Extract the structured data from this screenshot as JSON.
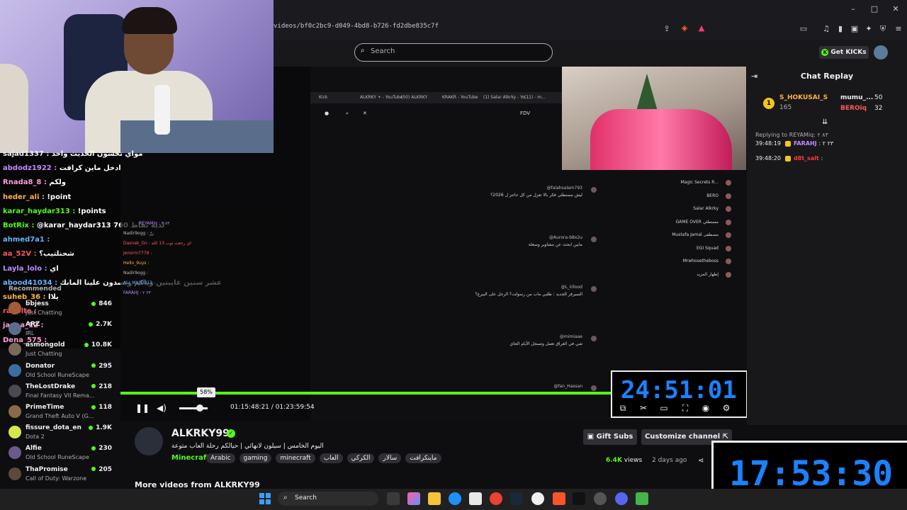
{
  "browser": {
    "url": "videos/bf0c2bc9-d049-4bd8-b726-fd2dbe835c7f"
  },
  "header": {
    "search_placeholder": "Search",
    "get_kicks": "Get KICKs"
  },
  "stream_chat_overlay": [
    {
      "user": "sajad1337 :",
      "msg": "مواي تحسون الحديث واحد",
      "color": "#efeff1"
    },
    {
      "user": "abdodz1922 :",
      "msg": "ادخل ماين كرافت",
      "color": "#c08cff"
    },
    {
      "user": "Rnada8_8 :",
      "msg": "ولكم",
      "color": "#ff9dd6"
    },
    {
      "user": "heder_ali :",
      "msg": "!point",
      "color": "#ffb347"
    },
    {
      "user": "karar_haydar313 :",
      "msg": "!points",
      "color": "#53fc18"
    },
    {
      "user": "BotRix :",
      "msg": "@karar_haydar313 لديه نقاط 760",
      "color": "#53fc18"
    },
    {
      "user": "ahmed7a1 :",
      "msg": "",
      "color": "#66b3ff"
    },
    {
      "user": "aa_52V :",
      "msg": "شحنلتيب؟",
      "color": "#ff5a5a"
    },
    {
      "user": "Layla_lolo :",
      "msg": "اي",
      "color": "#c08cff"
    },
    {
      "user": "abood41034 :",
      "msg": "عشر سنين غايبتين وياكم وتسدون علينا المابك",
      "color": "#66b3ff"
    },
    {
      "user": "suheb_36 :",
      "msg": "يلاا",
      "color": "#ffb347"
    },
    {
      "user": "rabolte :",
      "msg": "",
      "color": "#ff5a5a"
    },
    {
      "user": "janna_12 :",
      "msg": "",
      "color": "#ff9dd6"
    },
    {
      "user": "Dena_575 :",
      "msg": "",
      "color": "#ff9dd6"
    }
  ],
  "inner_chat": [
    {
      "user": "REYAMiq : ٨٣ ٢",
      "color": "#c08cff"
    },
    {
      "user": "Nadir9ogg : زرّ",
      "color": "#bdbdc2"
    },
    {
      "user": "Dasnak_Gn : اي رجعت توب 13 الله",
      "color": "#ff5a5a"
    },
    {
      "user": "Jenorm7778 :",
      "color": "#ff5a5a"
    },
    {
      "user": "Hello_9uys :",
      "color": "#ffb347"
    },
    {
      "user": "Nadir9ogg :",
      "color": "#bdbdc2"
    },
    {
      "user": "ALI_MAJID313 :",
      "color": "#66b3ff"
    },
    {
      "user": "FARAHJ : ٢٣ ٢",
      "color": "#c08cff"
    }
  ],
  "sidebar": {
    "recommended_label": "Recommended",
    "items": [
      {
        "name": "bbjess",
        "game": "Just Chatting",
        "viewers": "846",
        "color": "#a45b3a"
      },
      {
        "name": "ARZ",
        "game": "IRL",
        "viewers": "2.7K",
        "color": "#5a6e8c"
      },
      {
        "name": "asmongold",
        "game": "Just Chatting",
        "viewers": "10.8K",
        "color": "#7a6a5a"
      },
      {
        "name": "Donator",
        "game": "Old School RuneScape",
        "viewers": "295",
        "color": "#3a6ea5"
      },
      {
        "name": "TheLostDrake",
        "game": "Final Fantasy VII Rema...",
        "viewers": "218",
        "color": "#4a4a52"
      },
      {
        "name": "PrimeTime",
        "game": "Grand Theft Auto V (G...",
        "viewers": "118",
        "color": "#8b6a4a"
      },
      {
        "name": "fissure_dota_en",
        "game": "Dota 2",
        "viewers": "1.9K",
        "color": "#d7e94a"
      },
      {
        "name": "Alfie",
        "game": "Old School RuneScape",
        "viewers": "230",
        "color": "#6a5a8c"
      },
      {
        "name": "ThaPromise",
        "game": "Call of Duty: Warzone",
        "viewers": "205",
        "color": "#5a4a3a"
      }
    ]
  },
  "player": {
    "progress": 0.964,
    "volume_percent": "58%",
    "volume": 0.58,
    "current_time": "01:15:48:21",
    "separator": "/",
    "total_time": "01:23:59:54",
    "overlay_clock": "24:51:01"
  },
  "screenshare": {
    "tabs": [
      "Kick",
      "ALKRKY + - YouTube",
      "(50) ALKRKY",
      "KRAKR - YouTube",
      "(1) Salar Alkrky - Yo...",
      "(11) - m..."
    ],
    "search_label": "FDV",
    "comments": [
      {
        "user": "@falahsalam793",
        "text": "ليش مستطئي فكر بالا تعزل من كل حاجز ل 2026؟"
      },
      {
        "user": "@Aurora-b8x2u",
        "text": "مابين ابحث عن مشاوير وسعلة"
      },
      {
        "user": "@L_kllood",
        "text": "السيرفر الجديد : طلبي ماب من رسولت؟ الرجل على البيرغ؟"
      },
      {
        "user": "@mimiaae",
        "text": "شي في العراق تعمل وتسجل الأيام الجاي"
      },
      {
        "user": "@fan_Hassan",
        "text": ""
      }
    ],
    "side_channels": [
      "Magic Secrets R...",
      "BERO",
      "Salar Alkrky",
      "GAME OVER مستطئي",
      "Mustafa Jamal مصطفى",
      "EGI Squad",
      "Mrwhosetheboss",
      "إظهار المزيد"
    ]
  },
  "channel": {
    "name": "ALKRKY99",
    "title": "اليوم الخامس | سيلون لانهائي | حيالكم رحلة العاب متوعة",
    "category": "Minecraft",
    "tags": [
      "Arabic",
      "gaming",
      "minecraft",
      "العاب",
      "الكركي",
      "سالار",
      "ماينكرافت"
    ],
    "views_count": "6.4K",
    "views_label": "views",
    "posted": "2 days ago",
    "gift_subs": "Gift Subs",
    "customize": "Customize channel",
    "more_videos": "More videos from ALKRKY99"
  },
  "chat_replay": {
    "title": "Chat Replay",
    "leaderboard": [
      {
        "name": "S_HOKUSAI_S",
        "score": "165",
        "color": "#ffb347"
      },
      {
        "name": "mumu_...",
        "score": "50",
        "color": "#efeff1"
      },
      {
        "name": "BEROiq",
        "score": "32",
        "color": "#ff5a5a"
      }
    ],
    "reply_note": "Replying to REYAMiq: ٨٣ ٢",
    "messages": [
      {
        "time": "39:48:19",
        "user": "FARAHJ",
        "text": ": ٢٣ ٢",
        "color": "#c08cff"
      },
      {
        "time": "39:48:20",
        "user": "d8t_salt",
        "text": ":",
        "color": "#ff3b3b"
      }
    ]
  },
  "bottom_clock": "17:53:30",
  "taskbar": {
    "search_placeholder": "Search"
  }
}
